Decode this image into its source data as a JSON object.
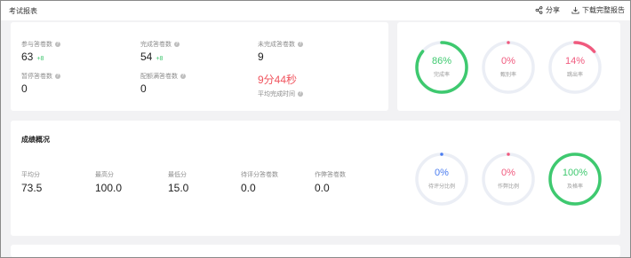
{
  "header": {
    "title": "考试报表",
    "share_label": "分享",
    "download_label": "下载完整报告"
  },
  "stats": {
    "participants": {
      "label": "参与答卷数",
      "value": "63",
      "delta": "+8"
    },
    "completed": {
      "label": "完成答卷数",
      "value": "54",
      "delta": "+8"
    },
    "unfinished": {
      "label": "未完成答卷数",
      "value": "9"
    },
    "interrupted": {
      "label": "暂停答卷数",
      "value": "0"
    },
    "quota_full": {
      "label": "配额满答卷数",
      "value": "0"
    },
    "avg_time": {
      "value": "9分44秒",
      "label": "平均完成时间"
    }
  },
  "rates": [
    {
      "value": "86%",
      "label": "完成率",
      "fraction": 0.86,
      "color": "#3ec96f"
    },
    {
      "value": "0%",
      "label": "甄别率",
      "fraction": 0.0,
      "color": "#f05a7e"
    },
    {
      "value": "14%",
      "label": "跳出率",
      "fraction": 0.14,
      "color": "#f05a7e"
    }
  ],
  "scores": {
    "section_title": "成绩概况",
    "items": [
      {
        "label": "平均分",
        "value": "73.5"
      },
      {
        "label": "最高分",
        "value": "100.0"
      },
      {
        "label": "最低分",
        "value": "15.0"
      },
      {
        "label": "待评分答卷数",
        "value": "0.0"
      },
      {
        "label": "作弊答卷数",
        "value": "0.0"
      }
    ]
  },
  "score_rates": [
    {
      "value": "0%",
      "label": "待评分比例",
      "fraction": 0.0,
      "color": "#4a7cf0"
    },
    {
      "value": "0%",
      "label": "作弊比例",
      "fraction": 0.0,
      "color": "#f05a7e"
    },
    {
      "value": "100%",
      "label": "及格率",
      "fraction": 1.0,
      "color": "#3ec96f"
    }
  ],
  "colors": {
    "track": "#ebeef5",
    "green": "#3ec96f",
    "red": "#f0545e"
  }
}
